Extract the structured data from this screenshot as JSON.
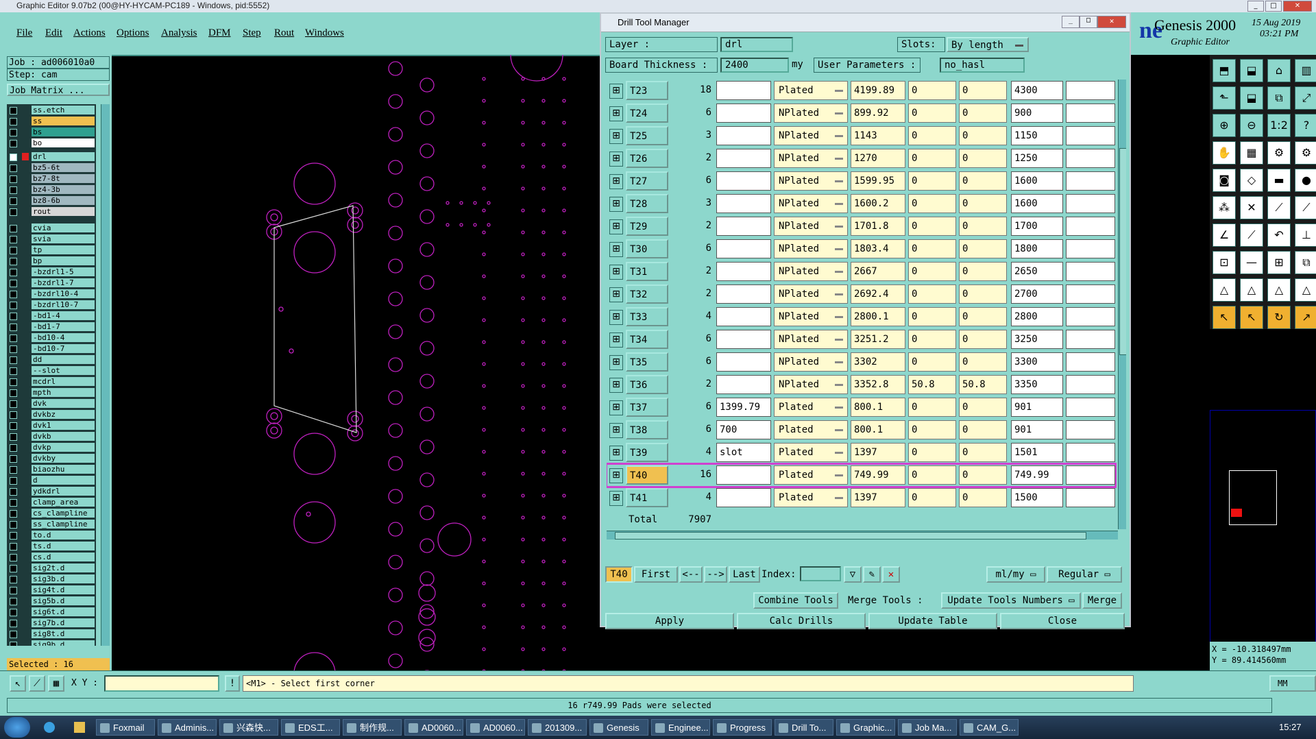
{
  "app": {
    "title": "Graphic Editor 9.07b2 (00@HY-HYCAM-PC189 - Windows, pid:5552)"
  },
  "menu": [
    "File",
    "Edit",
    "Actions",
    "Options",
    "Analysis",
    "DFM",
    "Step",
    "Rout",
    "Windows"
  ],
  "left": {
    "job": "Job : ad006010a0",
    "step": "Step: cam",
    "matrix_btn": "Job Matrix ...",
    "selected": "Selected : 16",
    "layers_top": [
      "ss.etch",
      "ss",
      "bs",
      "bo"
    ],
    "layers": [
      "drl",
      "bz5-6t",
      "bz7-8t",
      "bz4-3b",
      "bz8-6b",
      "rout",
      "cvia",
      "svia",
      "tp",
      "bp",
      "-bzdrl1-5",
      "-bzdrl1-7",
      "-bzdrl10-4",
      "-bzdrl10-7",
      "-bd1-4",
      "-bd1-7",
      "-bd10-4",
      "-bd10-7",
      "dd",
      "--slot",
      "mcdrl",
      "mpth",
      "dvk",
      "dvkbz",
      "dvk1",
      "dvkb",
      "dvkp",
      "dvkby",
      "biaozhu",
      "d",
      "ydkdrl",
      "clamp_area",
      "cs_clampline",
      "ss_clampline",
      "to.d",
      "ts.d",
      "cs.d",
      "sig2t.d",
      "sig3b.d",
      "sig4t.d",
      "sig5b.d",
      "sig6t.d",
      "sig7b.d",
      "sig8t.d",
      "sig9b.d"
    ]
  },
  "genesis": {
    "title": "Genesis 2000",
    "subtitle": "Graphic Editor",
    "date": "15 Aug 2019",
    "time": "03:21 PM"
  },
  "coords": {
    "x": "X = -10.318497mm",
    "y": "Y = 89.414560mm"
  },
  "dialog": {
    "title": "Drill Tool Manager",
    "layer_label": "Layer :",
    "layer_value": "drl",
    "slots_label": "Slots:",
    "slots_value": "By length",
    "thickness_label": "Board Thickness :",
    "thickness_value": "2400",
    "thickness_unit": "my",
    "user_params_label": "User Parameters :",
    "user_params_value": "no_hasl",
    "rows": [
      {
        "tool": "T23",
        "count": "18",
        "w1": "",
        "type": "Plated",
        "v1": "4199.89",
        "v2": "0",
        "v3": "0",
        "v4": "4300",
        "w2": ""
      },
      {
        "tool": "T24",
        "count": "6",
        "w1": "",
        "type": "NPlated",
        "v1": "899.92",
        "v2": "0",
        "v3": "0",
        "v4": "900",
        "w2": ""
      },
      {
        "tool": "T25",
        "count": "3",
        "w1": "",
        "type": "NPlated",
        "v1": "1143",
        "v2": "0",
        "v3": "0",
        "v4": "1150",
        "w2": ""
      },
      {
        "tool": "T26",
        "count": "2",
        "w1": "",
        "type": "NPlated",
        "v1": "1270",
        "v2": "0",
        "v3": "0",
        "v4": "1250",
        "w2": ""
      },
      {
        "tool": "T27",
        "count": "6",
        "w1": "",
        "type": "NPlated",
        "v1": "1599.95",
        "v2": "0",
        "v3": "0",
        "v4": "1600",
        "w2": ""
      },
      {
        "tool": "T28",
        "count": "3",
        "w1": "",
        "type": "NPlated",
        "v1": "1600.2",
        "v2": "0",
        "v3": "0",
        "v4": "1600",
        "w2": ""
      },
      {
        "tool": "T29",
        "count": "2",
        "w1": "",
        "type": "NPlated",
        "v1": "1701.8",
        "v2": "0",
        "v3": "0",
        "v4": "1700",
        "w2": ""
      },
      {
        "tool": "T30",
        "count": "6",
        "w1": "",
        "type": "NPlated",
        "v1": "1803.4",
        "v2": "0",
        "v3": "0",
        "v4": "1800",
        "w2": ""
      },
      {
        "tool": "T31",
        "count": "2",
        "w1": "",
        "type": "NPlated",
        "v1": "2667",
        "v2": "0",
        "v3": "0",
        "v4": "2650",
        "w2": ""
      },
      {
        "tool": "T32",
        "count": "2",
        "w1": "",
        "type": "NPlated",
        "v1": "2692.4",
        "v2": "0",
        "v3": "0",
        "v4": "2700",
        "w2": ""
      },
      {
        "tool": "T33",
        "count": "4",
        "w1": "",
        "type": "NPlated",
        "v1": "2800.1",
        "v2": "0",
        "v3": "0",
        "v4": "2800",
        "w2": ""
      },
      {
        "tool": "T34",
        "count": "6",
        "w1": "",
        "type": "NPlated",
        "v1": "3251.2",
        "v2": "0",
        "v3": "0",
        "v4": "3250",
        "w2": ""
      },
      {
        "tool": "T35",
        "count": "6",
        "w1": "",
        "type": "NPlated",
        "v1": "3302",
        "v2": "0",
        "v3": "0",
        "v4": "3300",
        "w2": ""
      },
      {
        "tool": "T36",
        "count": "2",
        "w1": "",
        "type": "NPlated",
        "v1": "3352.8",
        "v2": "50.8",
        "v3": "50.8",
        "v4": "3350",
        "w2": ""
      },
      {
        "tool": "T37",
        "count": "6",
        "w1": "1399.79",
        "type": "Plated",
        "v1": "800.1",
        "v2": "0",
        "v3": "0",
        "v4": "901",
        "w2": ""
      },
      {
        "tool": "T38",
        "count": "6",
        "w1": "700",
        "type": "Plated",
        "v1": "800.1",
        "v2": "0",
        "v3": "0",
        "v4": "901",
        "w2": ""
      },
      {
        "tool": "T39",
        "count": "4",
        "w1": "slot",
        "type": "Plated",
        "v1": "1397",
        "v2": "0",
        "v3": "0",
        "v4": "1501",
        "w2": ""
      },
      {
        "tool": "T40",
        "count": "16",
        "w1": "",
        "type": "Plated",
        "v1": "749.99",
        "v2": "0",
        "v3": "0",
        "v4": "749.99",
        "w2": ""
      },
      {
        "tool": "T41",
        "count": "4",
        "w1": "",
        "type": "Plated",
        "v1": "1397",
        "v2": "0",
        "v3": "0",
        "v4": "1500",
        "w2": ""
      }
    ],
    "total_label": "Total",
    "total_value": "7907",
    "nav": {
      "current": "T40",
      "first": "First",
      "prev": "<--",
      "next": "-->",
      "last": "Last",
      "index_label": "Index:",
      "units": "ml/my",
      "mode": "Regular"
    },
    "combine": "Combine Tools",
    "merge_label": "Merge Tools :",
    "update_numbers": "Update Tools Numbers",
    "merge": "Merge",
    "apply": "Apply",
    "calc": "Calc Drills",
    "update_table": "Update Table",
    "close": "Close"
  },
  "bottom": {
    "xy_label": "X Y :",
    "prompt": "<M1> - Select first corner",
    "status": "16 r749.99 Pads were selected",
    "mm": "MM"
  },
  "taskbar": {
    "items": [
      "Foxmail",
      "Adminis...",
      "兴森快...",
      "EDS工...",
      "制作规...",
      "AD0060...",
      "AD0060...",
      "201309...",
      "Genesis",
      "Enginee...",
      "Progress",
      "Drill To...",
      "Graphic...",
      "Job Ma...",
      "CAM_G..."
    ],
    "clock": "15:27"
  }
}
